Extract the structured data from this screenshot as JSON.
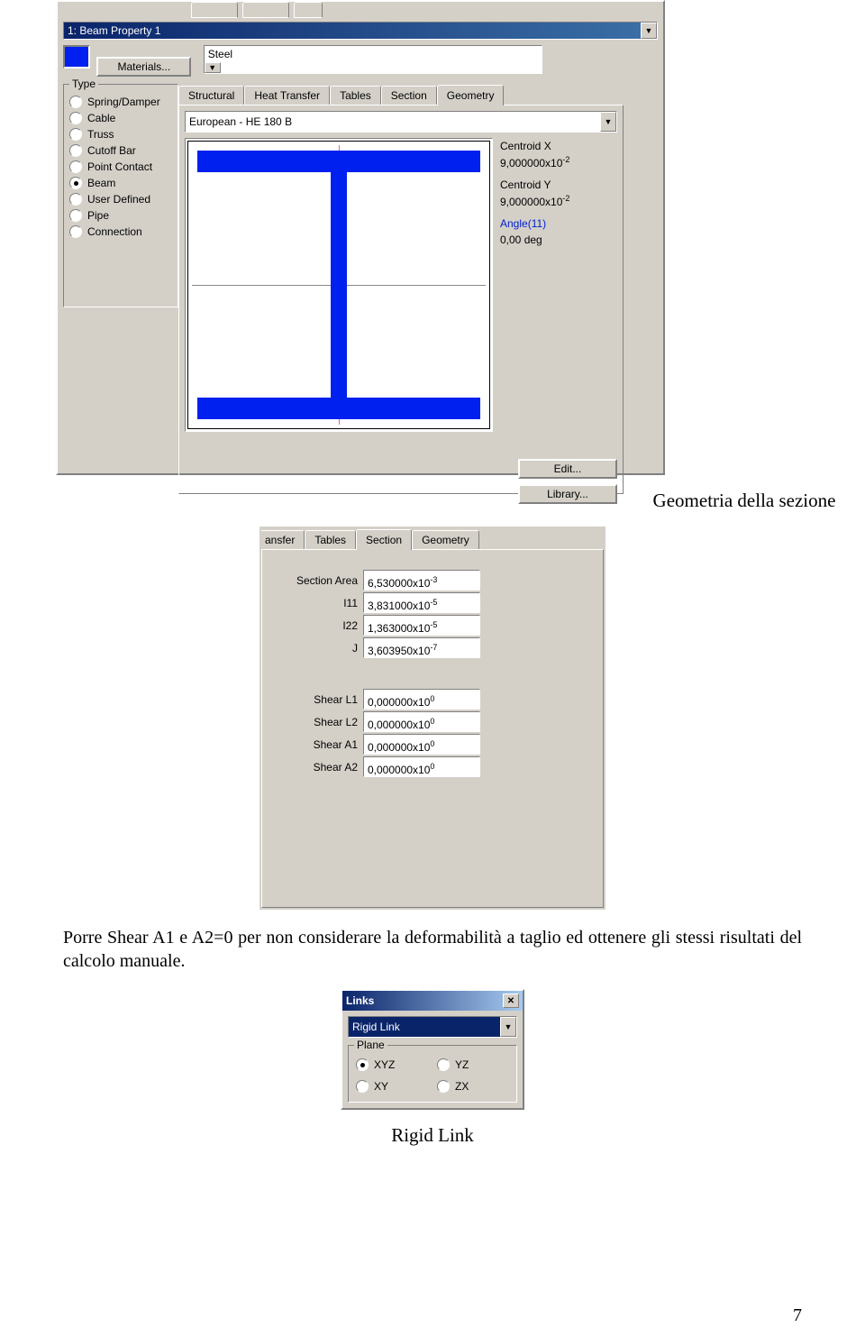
{
  "screenshot1": {
    "dropdown_value": "1: Beam Property 1",
    "materials_button": "Materials...",
    "material_value": "Steel",
    "type_group": "Type",
    "type_options": [
      "Spring/Damper",
      "Cable",
      "Truss",
      "Cutoff Bar",
      "Point Contact",
      "Beam",
      "User Defined",
      "Pipe",
      "Connection"
    ],
    "type_selected": "Beam",
    "tabs": [
      "Structural",
      "Heat Transfer",
      "Tables",
      "Section",
      "Geometry"
    ],
    "tabs_active": "Geometry",
    "section_value": "European - HE 180 B",
    "centroid_x_label": "Centroid X",
    "centroid_x_value": "9,000000x10",
    "centroid_x_exp": "-2",
    "centroid_y_label": "Centroid Y",
    "centroid_y_value": "9,000000x10",
    "centroid_y_exp": "-2",
    "angle_label": "Angle(11)",
    "angle_value": "0,00 deg",
    "edit_button": "Edit...",
    "library_button": "Library..."
  },
  "caption1": "Geometria della sezione",
  "screenshot2": {
    "tabs_left": [
      "ansfer",
      "Tables"
    ],
    "tabs": [
      "Section",
      "Geometry"
    ],
    "tabs_active": "Section",
    "rows": [
      {
        "label": "Section Area",
        "value": "6,530000x10",
        "exp": "-3"
      },
      {
        "label": "I11",
        "value": "3,831000x10",
        "exp": "-5"
      },
      {
        "label": "I22",
        "value": "1,363000x10",
        "exp": "-5"
      },
      {
        "label": "J",
        "value": "3,603950x10",
        "exp": "-7"
      }
    ],
    "rows2": [
      {
        "label": "Shear L1",
        "value": "0,000000x10",
        "exp": "0"
      },
      {
        "label": "Shear L2",
        "value": "0,000000x10",
        "exp": "0"
      },
      {
        "label": "Shear A1",
        "value": "0,000000x10",
        "exp": "0"
      },
      {
        "label": "Shear A2",
        "value": "0,000000x10",
        "exp": "0"
      }
    ]
  },
  "paragraph": "Porre Shear A1 e A2=0 per non considerare la deformabilità a taglio ed ottenere gli stessi risultati del calcolo manuale.",
  "screenshot3": {
    "title": "Links",
    "dropdown": "Rigid Link",
    "group": "Plane",
    "options": [
      "XYZ",
      "YZ",
      "XY",
      "ZX"
    ],
    "selected": "XYZ"
  },
  "caption2": "Rigid Link",
  "page_number": "7"
}
